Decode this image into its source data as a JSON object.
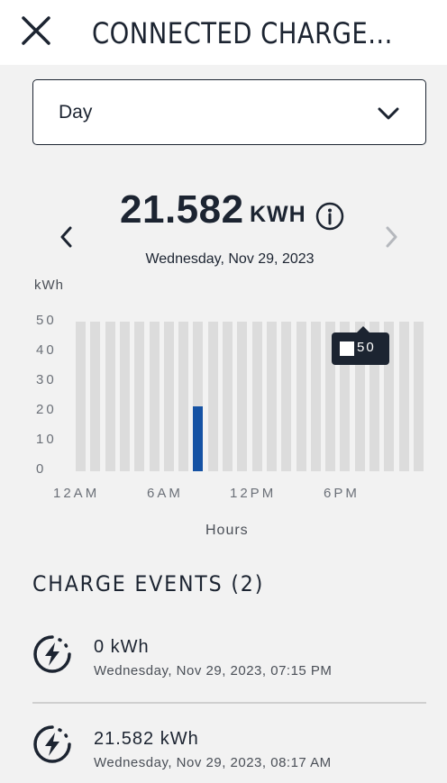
{
  "header": {
    "title": "CONNECTED CHARGE...",
    "close_icon": "close-icon"
  },
  "period_selector": {
    "value": "Day",
    "icon": "chevron-down-icon"
  },
  "summary": {
    "total": "21.582",
    "unit": "KWH",
    "date": "Wednesday, Nov 29, 2023",
    "prev_icon": "chevron-left-icon",
    "next_icon": "chevron-right-icon",
    "info_icon": "info-icon"
  },
  "chart_data": {
    "type": "bar",
    "ylabel": "kWh",
    "xlabel": "Hours",
    "ylim": [
      0,
      50
    ],
    "yticks": [
      "50",
      "40",
      "30",
      "20",
      "10",
      "0"
    ],
    "xticks": [
      "12AM",
      "6AM",
      "12PM",
      "6PM"
    ],
    "categories": [
      "0",
      "1",
      "2",
      "3",
      "4",
      "5",
      "6",
      "7",
      "8",
      "9",
      "10",
      "11",
      "12",
      "13",
      "14",
      "15",
      "16",
      "17",
      "18",
      "19",
      "20",
      "21",
      "22",
      "23"
    ],
    "values": [
      0,
      0,
      0,
      0,
      0,
      0,
      0,
      0,
      21.582,
      0,
      0,
      0,
      0,
      0,
      0,
      0,
      0,
      0,
      0,
      0,
      0,
      0,
      0,
      0
    ],
    "bar_color": "#1552a4",
    "background_bar_color": "#dcdcdc",
    "tooltip": "50",
    "grid": false
  },
  "events": {
    "title": "CHARGE EVENTS (2)",
    "items": [
      {
        "amount": "0 kWh",
        "time": "Wednesday, Nov 29, 2023, 07:15 PM",
        "icon": "charging-bolt-icon"
      },
      {
        "amount": "21.582 kWh",
        "time": "Wednesday, Nov 29, 2023, 08:17 AM",
        "icon": "charging-bolt-icon"
      }
    ]
  },
  "colors": {
    "text": "#1c2431",
    "accent": "#1552a4",
    "background": "#f2f2f2"
  }
}
